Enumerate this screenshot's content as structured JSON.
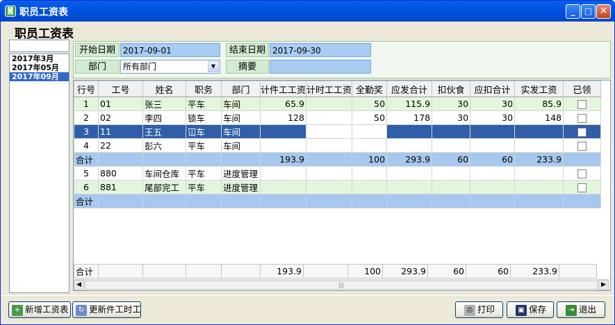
{
  "window": {
    "title": "职员工资表",
    "min_glyph": "_",
    "max_glyph": "□",
    "close_glyph": "✕"
  },
  "page": {
    "heading": "职员工资表"
  },
  "months": [
    "2017年3月",
    "2017年05月",
    "2017年09月"
  ],
  "selected_month_index": 2,
  "filter": {
    "start_label": "开始日期",
    "start_value": "2017-09-01",
    "end_label": "结束日期",
    "end_value": "2017-09-30",
    "dept_label": "部门",
    "dept_value": "所有部门",
    "summary_label": "摘要",
    "summary_value": ""
  },
  "grid": {
    "columns": [
      "行号",
      "工号",
      "姓名",
      "职务",
      "部门",
      "计件工工资",
      "计时工工资",
      "全勤奖",
      "应发合计",
      "扣伙食",
      "应扣合计",
      "实发工资",
      "已领"
    ],
    "rows": [
      {
        "type": "data",
        "style": "green",
        "cells": [
          "1",
          "01",
          "张三",
          "平车",
          "车间",
          "65.9",
          "",
          "50",
          "115.9",
          "30",
          "30",
          "85.9"
        ]
      },
      {
        "type": "data",
        "style": "white",
        "cells": [
          "2",
          "02",
          "李四",
          "锁车",
          "车间",
          "128",
          "",
          "50",
          "178",
          "30",
          "30",
          "148"
        ]
      },
      {
        "type": "data",
        "style": "sel",
        "cells": [
          "3",
          "11",
          "王五",
          "冚车",
          "车间",
          "",
          "",
          "",
          "",
          "",
          "",
          "",
          ""
        ]
      },
      {
        "type": "data",
        "style": "white",
        "cells": [
          "4",
          "22",
          "彭六",
          "平车",
          "车间",
          "",
          "",
          "",
          "",
          "",
          "",
          "",
          ""
        ]
      },
      {
        "type": "total",
        "cells": [
          "合计",
          "",
          "",
          "",
          "",
          "193.9",
          "",
          "100",
          "293.9",
          "60",
          "60",
          "233.9",
          ""
        ]
      },
      {
        "type": "data",
        "style": "white",
        "cells": [
          "5",
          "880",
          "车间仓库",
          "平车",
          "进度管理",
          "",
          "",
          "",
          "",
          "",
          "",
          "",
          ""
        ]
      },
      {
        "type": "data",
        "style": "green",
        "cells": [
          "6",
          "881",
          "尾部完工",
          "平车",
          "进度管理",
          "",
          "",
          "",
          "",
          "",
          "",
          "",
          ""
        ]
      },
      {
        "type": "total",
        "cells": [
          "合计",
          "",
          "",
          "",
          "",
          "",
          "",
          "",
          "",
          "",
          "",
          "",
          ""
        ]
      }
    ],
    "footer": [
      "合计",
      "",
      "",
      "",
      "",
      "193.9",
      "",
      "100",
      "293.9",
      "60",
      "60",
      "233.9",
      ""
    ],
    "scroll_left": "◀",
    "scroll_right": "▶",
    "scroll_grip": "|||"
  },
  "toolbar": {
    "add_label": "新增工资表",
    "update_label": "更新件工时工",
    "print_label": "打印",
    "save_label": "保存",
    "exit_label": "退出"
  }
}
